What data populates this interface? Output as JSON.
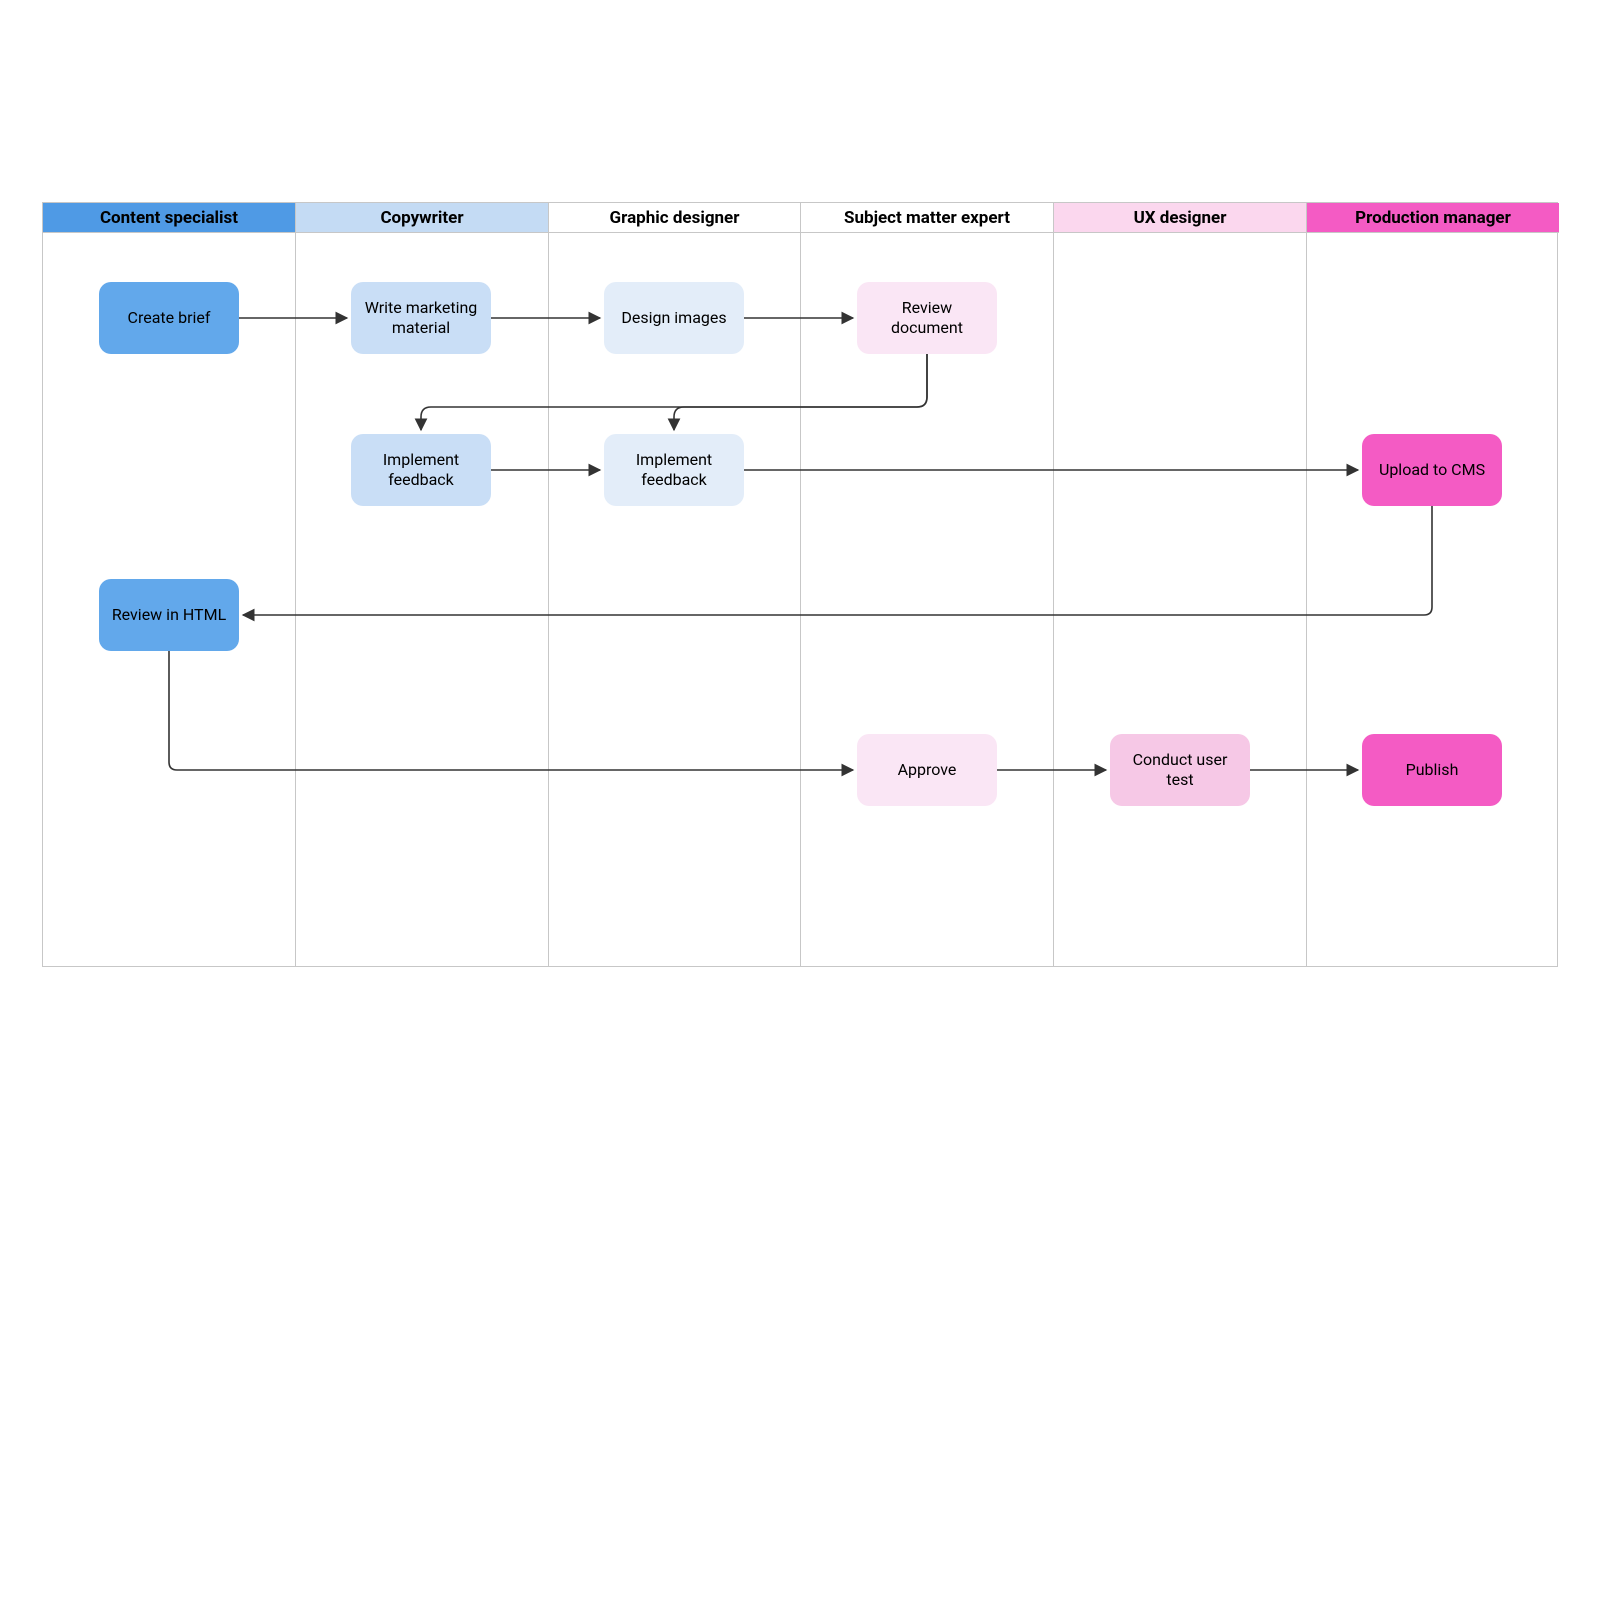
{
  "lanes": [
    {
      "key": "content_specialist",
      "label": "Content specialist",
      "header_bg": "#4f9ae5"
    },
    {
      "key": "copywriter",
      "label": "Copywriter",
      "header_bg": "#c4dbf4"
    },
    {
      "key": "graphic_designer",
      "label": "Graphic designer",
      "header_bg": "#ffffff"
    },
    {
      "key": "subject_matter_expert",
      "label": "Subject matter expert",
      "header_bg": "#ffffff"
    },
    {
      "key": "ux_designer",
      "label": "UX designer",
      "header_bg": "#fbd7ee"
    },
    {
      "key": "production_manager",
      "label": "Production manager",
      "header_bg": "#f45bc4"
    }
  ],
  "nodes": {
    "create_brief": {
      "label": "Create brief"
    },
    "write_marketing": {
      "label": "Write marketing material"
    },
    "design_images": {
      "label": "Design images"
    },
    "review_document": {
      "label": "Review document"
    },
    "impl_feedback_copy": {
      "label": "Implement feedback"
    },
    "impl_feedback_design": {
      "label": "Implement feedback"
    },
    "upload_cms": {
      "label": "Upload to CMS"
    },
    "review_html": {
      "label": "Review in HTML"
    },
    "approve": {
      "label": "Approve"
    },
    "conduct_user_test": {
      "label": "Conduct user test"
    },
    "publish": {
      "label": "Publish"
    }
  }
}
